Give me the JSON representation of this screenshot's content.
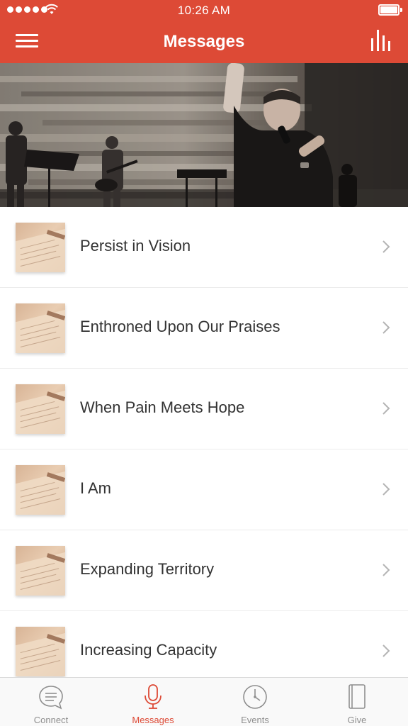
{
  "status_bar": {
    "time": "10:26 AM",
    "signal_icon": "signal-dots-icon",
    "wifi_icon": "wifi-icon",
    "battery_icon": "battery-icon"
  },
  "header": {
    "title": "Messages",
    "menu_icon": "hamburger-menu-icon",
    "stats_icon": "bar-chart-icon",
    "background_color": "#dd4a36"
  },
  "hero": {
    "image": "worship-band-stage-photo"
  },
  "messages": [
    {
      "title": "Persist in Vision"
    },
    {
      "title": "Enthroned Upon Our Praises"
    },
    {
      "title": "When Pain Meets Hope"
    },
    {
      "title": "I Am"
    },
    {
      "title": "Expanding Territory"
    },
    {
      "title": "Increasing Capacity"
    }
  ],
  "tabbar": {
    "tabs": [
      {
        "label": "Connect",
        "icon": "chat-bubble-icon",
        "active": false
      },
      {
        "label": "Messages",
        "icon": "microphone-icon",
        "active": true
      },
      {
        "label": "Events",
        "icon": "clock-icon",
        "active": false
      },
      {
        "label": "Give",
        "icon": "notebook-icon",
        "active": false
      }
    ],
    "active_color": "#dd4a36",
    "inactive_color": "#8e8e8e"
  }
}
